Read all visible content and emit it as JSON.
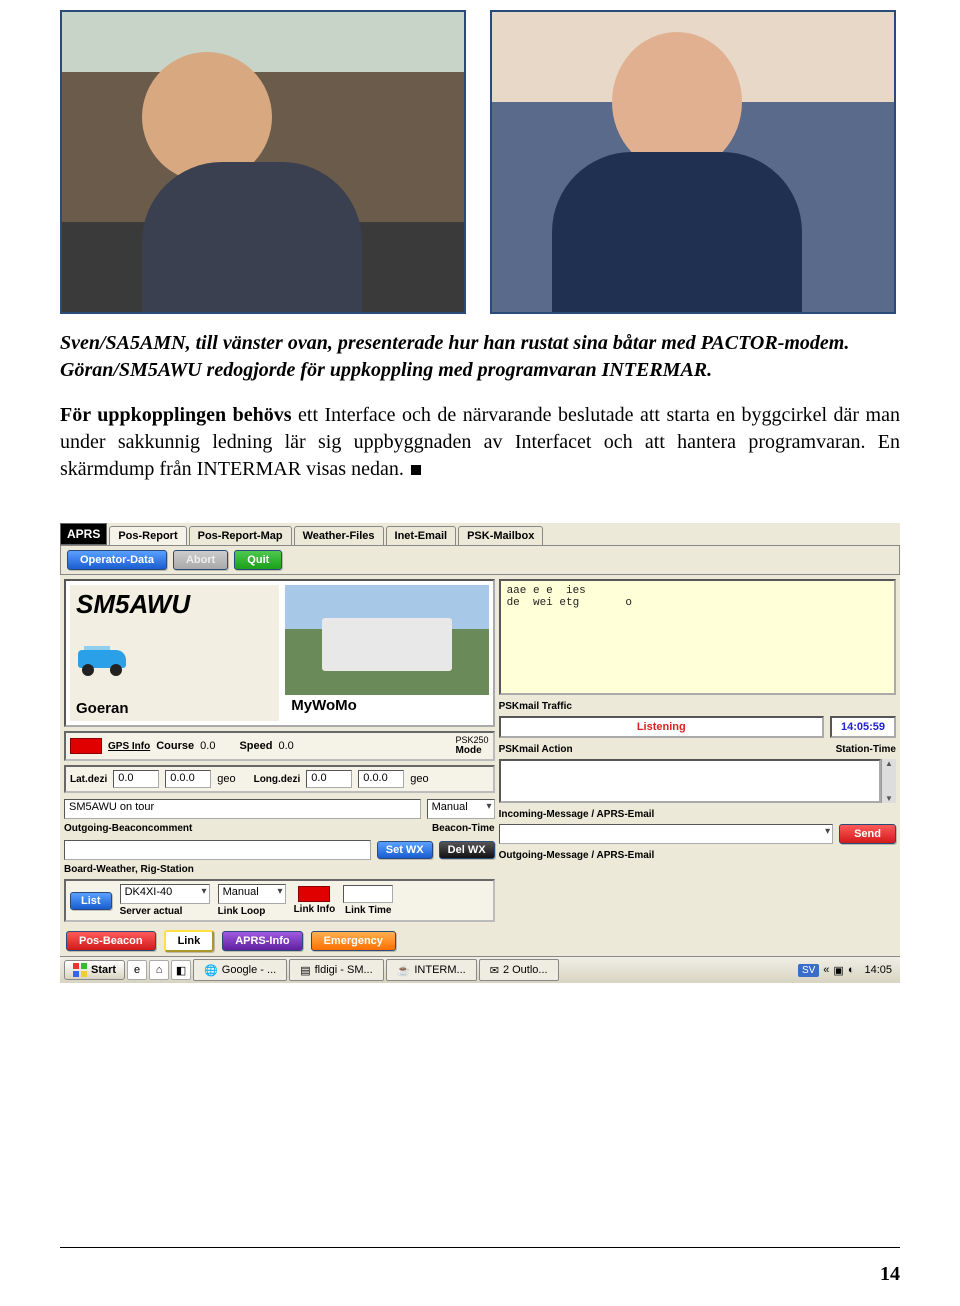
{
  "caption": "Sven/SA5AMN, till vänster ovan, presenterade hur han rustat sina båtar med PACTOR-modem. Göran/SM5AWU redogjorde för uppkoppling med programvaran INTERMAR.",
  "body_lead": "För uppkopplingen behövs",
  "body_rest": " ett Interface och de närvarande beslutade att starta en byggcirkel där man under sakkunnig ledning lär sig uppbyggnaden av Interfacet och att hantera programvaran. En skärmdump från INTERMAR visas nedan.",
  "page_number": "14",
  "app": {
    "badge": "APRS",
    "tabs": [
      "Pos-Report",
      "Pos-Report-Map",
      "Weather-Files",
      "Inet-Email",
      "PSK-Mailbox"
    ],
    "actions": {
      "operator": "Operator-Data",
      "abort": "Abort",
      "quit": "Quit"
    },
    "callsign": "SM5AWU",
    "operator_name": "Goeran",
    "vehicle_name": "MyWoMo",
    "gps": {
      "gps_info": "GPS Info",
      "course_label": "Course",
      "course": "0.0",
      "speed_label": "Speed",
      "speed": "0.0",
      "mode_top": "PSK250",
      "mode_bottom": "Mode"
    },
    "coords": {
      "lat_label": "Lat.dezi",
      "lat1": "0.0",
      "lat2": "0.0.0",
      "lat_geo": "geo",
      "lon_label": "Long.dezi",
      "lon1": "0.0",
      "lon2": "0.0.0",
      "lon_geo": "geo"
    },
    "outgoing_value": "SM5AWU on tour",
    "beacon_time": "Manual",
    "outgoing_label": "Outgoing-Beaconcomment",
    "beacon_time_label": "Beacon-Time",
    "wx": {
      "set": "Set WX",
      "del": "Del WX"
    },
    "wx_label": "Board-Weather, Rig-Station",
    "server": {
      "list": "List",
      "server": "DK4XI-40",
      "server_label": "Server actual",
      "loop_mode": "Manual",
      "loop_label": "Link Loop",
      "info_label": "Link Info",
      "time_label": "Link Time"
    },
    "right": {
      "console_l1": "aae e e  ies",
      "console_l2": "de  wei etg       o",
      "traffic_label": "PSKmail Traffic",
      "listening": "Listening",
      "station_time": "14:05:59",
      "action_label": "PSKmail Action",
      "station_time_label": "Station-Time",
      "incoming_label": "Incoming-Message / APRS-Email",
      "send": "Send",
      "outgoing_label": "Outgoing-Message / APRS-Email"
    },
    "bottom": {
      "pos_beacon": "Pos-Beacon",
      "link": "Link",
      "aprs_info": "APRS-Info",
      "emergency": "Emergency"
    }
  },
  "taskbar": {
    "start": "Start",
    "tasks": [
      "Google - ...",
      "fldigi - SM...",
      "INTERM...",
      "2 Outlo..."
    ],
    "lang": "SV",
    "clock": "14:05"
  }
}
